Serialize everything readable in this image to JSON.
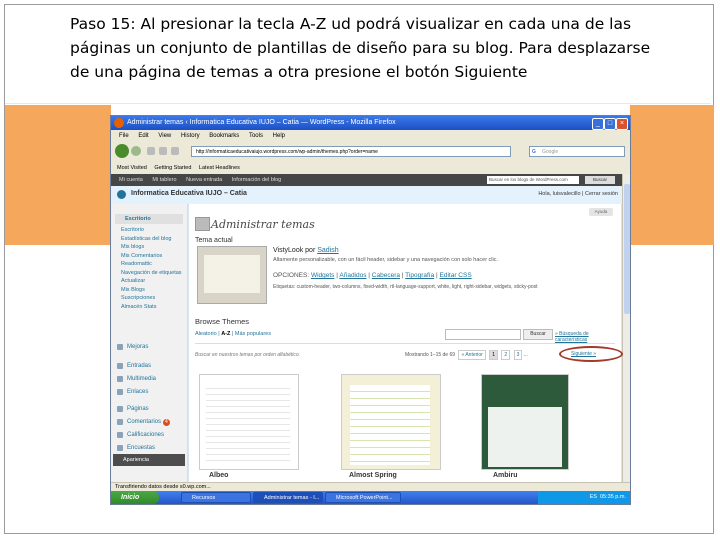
{
  "caption": "Paso 15: Al presionar la tecla A-Z ud podrá visualizar en cada una de las páginas un conjunto de plantillas de diseño para su blog. Para desplazarse de una página de temas a otra presione el botón Siguiente",
  "browser": {
    "title": "Administrar temas ‹ Informatica Educativa IUJO – Catia — WordPress - Mozilla Firefox",
    "menu": [
      "File",
      "Edit",
      "View",
      "History",
      "Bookmarks",
      "Tools",
      "Help"
    ],
    "url": "http://informaticaeducativaiujo.wordpress.com/wp-admin/themes.php?order=name",
    "search_placeholder": "Google",
    "bookmarks": [
      "Most Visited",
      "Getting Started",
      "Latest Headlines"
    ]
  },
  "wpbar": {
    "items": [
      "Mi cuenta",
      "Mi tablero",
      "Nueva entrada",
      "Información del blog"
    ],
    "search_placeholder": "Buscar en los blogs de WordPress.com",
    "search_button": "Buscar"
  },
  "header": {
    "blog_name": "Informatica Educativa IUJO – Catia",
    "user": "Hola, luisvalecillo | Cerrar sesión"
  },
  "sidebar": {
    "top": "Escritorio",
    "subs": [
      "Escritorio",
      "Estadísticas del blog",
      "Mis blogs",
      "Mis Comentarios",
      "Readomattic",
      "Navegación de etiquetas",
      "Actualizar",
      "Mis Blogs",
      "Suscripciones",
      "Almacén Stats"
    ],
    "menus": [
      {
        "label": "Mejoras",
        "badge": ""
      },
      {
        "label": "Entradas",
        "badge": ""
      },
      {
        "label": "Multimedia",
        "badge": ""
      },
      {
        "label": "Enlaces",
        "badge": ""
      },
      {
        "label": "Páginas",
        "badge": ""
      },
      {
        "label": "Comentarios",
        "badge": "4"
      },
      {
        "label": "Calificaciones",
        "badge": ""
      },
      {
        "label": "Encuestas",
        "badge": ""
      }
    ],
    "appearance": "Apariencia"
  },
  "main": {
    "title": "Administrar temas",
    "help": "Ayuda",
    "current_label": "Tema actual",
    "current_name_prefix": "VistyLook por",
    "current_author": "Sadish",
    "current_desc": "Altamente personalizable, con un fácil header, sidebar y una navegación con solo hacer clic.",
    "options_label": "OPCIONES:",
    "options": [
      "Widgets",
      "Añadidos",
      "Cabecera",
      "Tipografía",
      "Editar CSS"
    ],
    "tags": "Etiquetas: custom-header, two-columns, fixed-width, rtl-language-support, white, light, right-sidebar, widgets, sticky-post",
    "browse_label": "Browse Themes",
    "tabs": [
      "Aleatorio",
      "A-Z",
      "Más populares"
    ],
    "search_button": "Buscar",
    "search_link": "» Búsqueda de características",
    "sort_note": "Buscar en nuestros temas por orden alfabético.",
    "pager_text": "Mostrando 1–15 de 69",
    "prev": "« Anterior",
    "pages": [
      "1",
      "2",
      "3",
      "..."
    ],
    "next": "Siguiente »",
    "themes": [
      "Albeo",
      "Almost Spring",
      "Ambiru"
    ]
  },
  "status": "Transfiriendo datos desde s0.wp.com...",
  "taskbar": {
    "start": "Inicio",
    "tasks": [
      "Recursos",
      "Administrar temas - I...",
      "Microsoft PowerPoint..."
    ],
    "lang": "ES",
    "time": "05:35 p.m."
  }
}
